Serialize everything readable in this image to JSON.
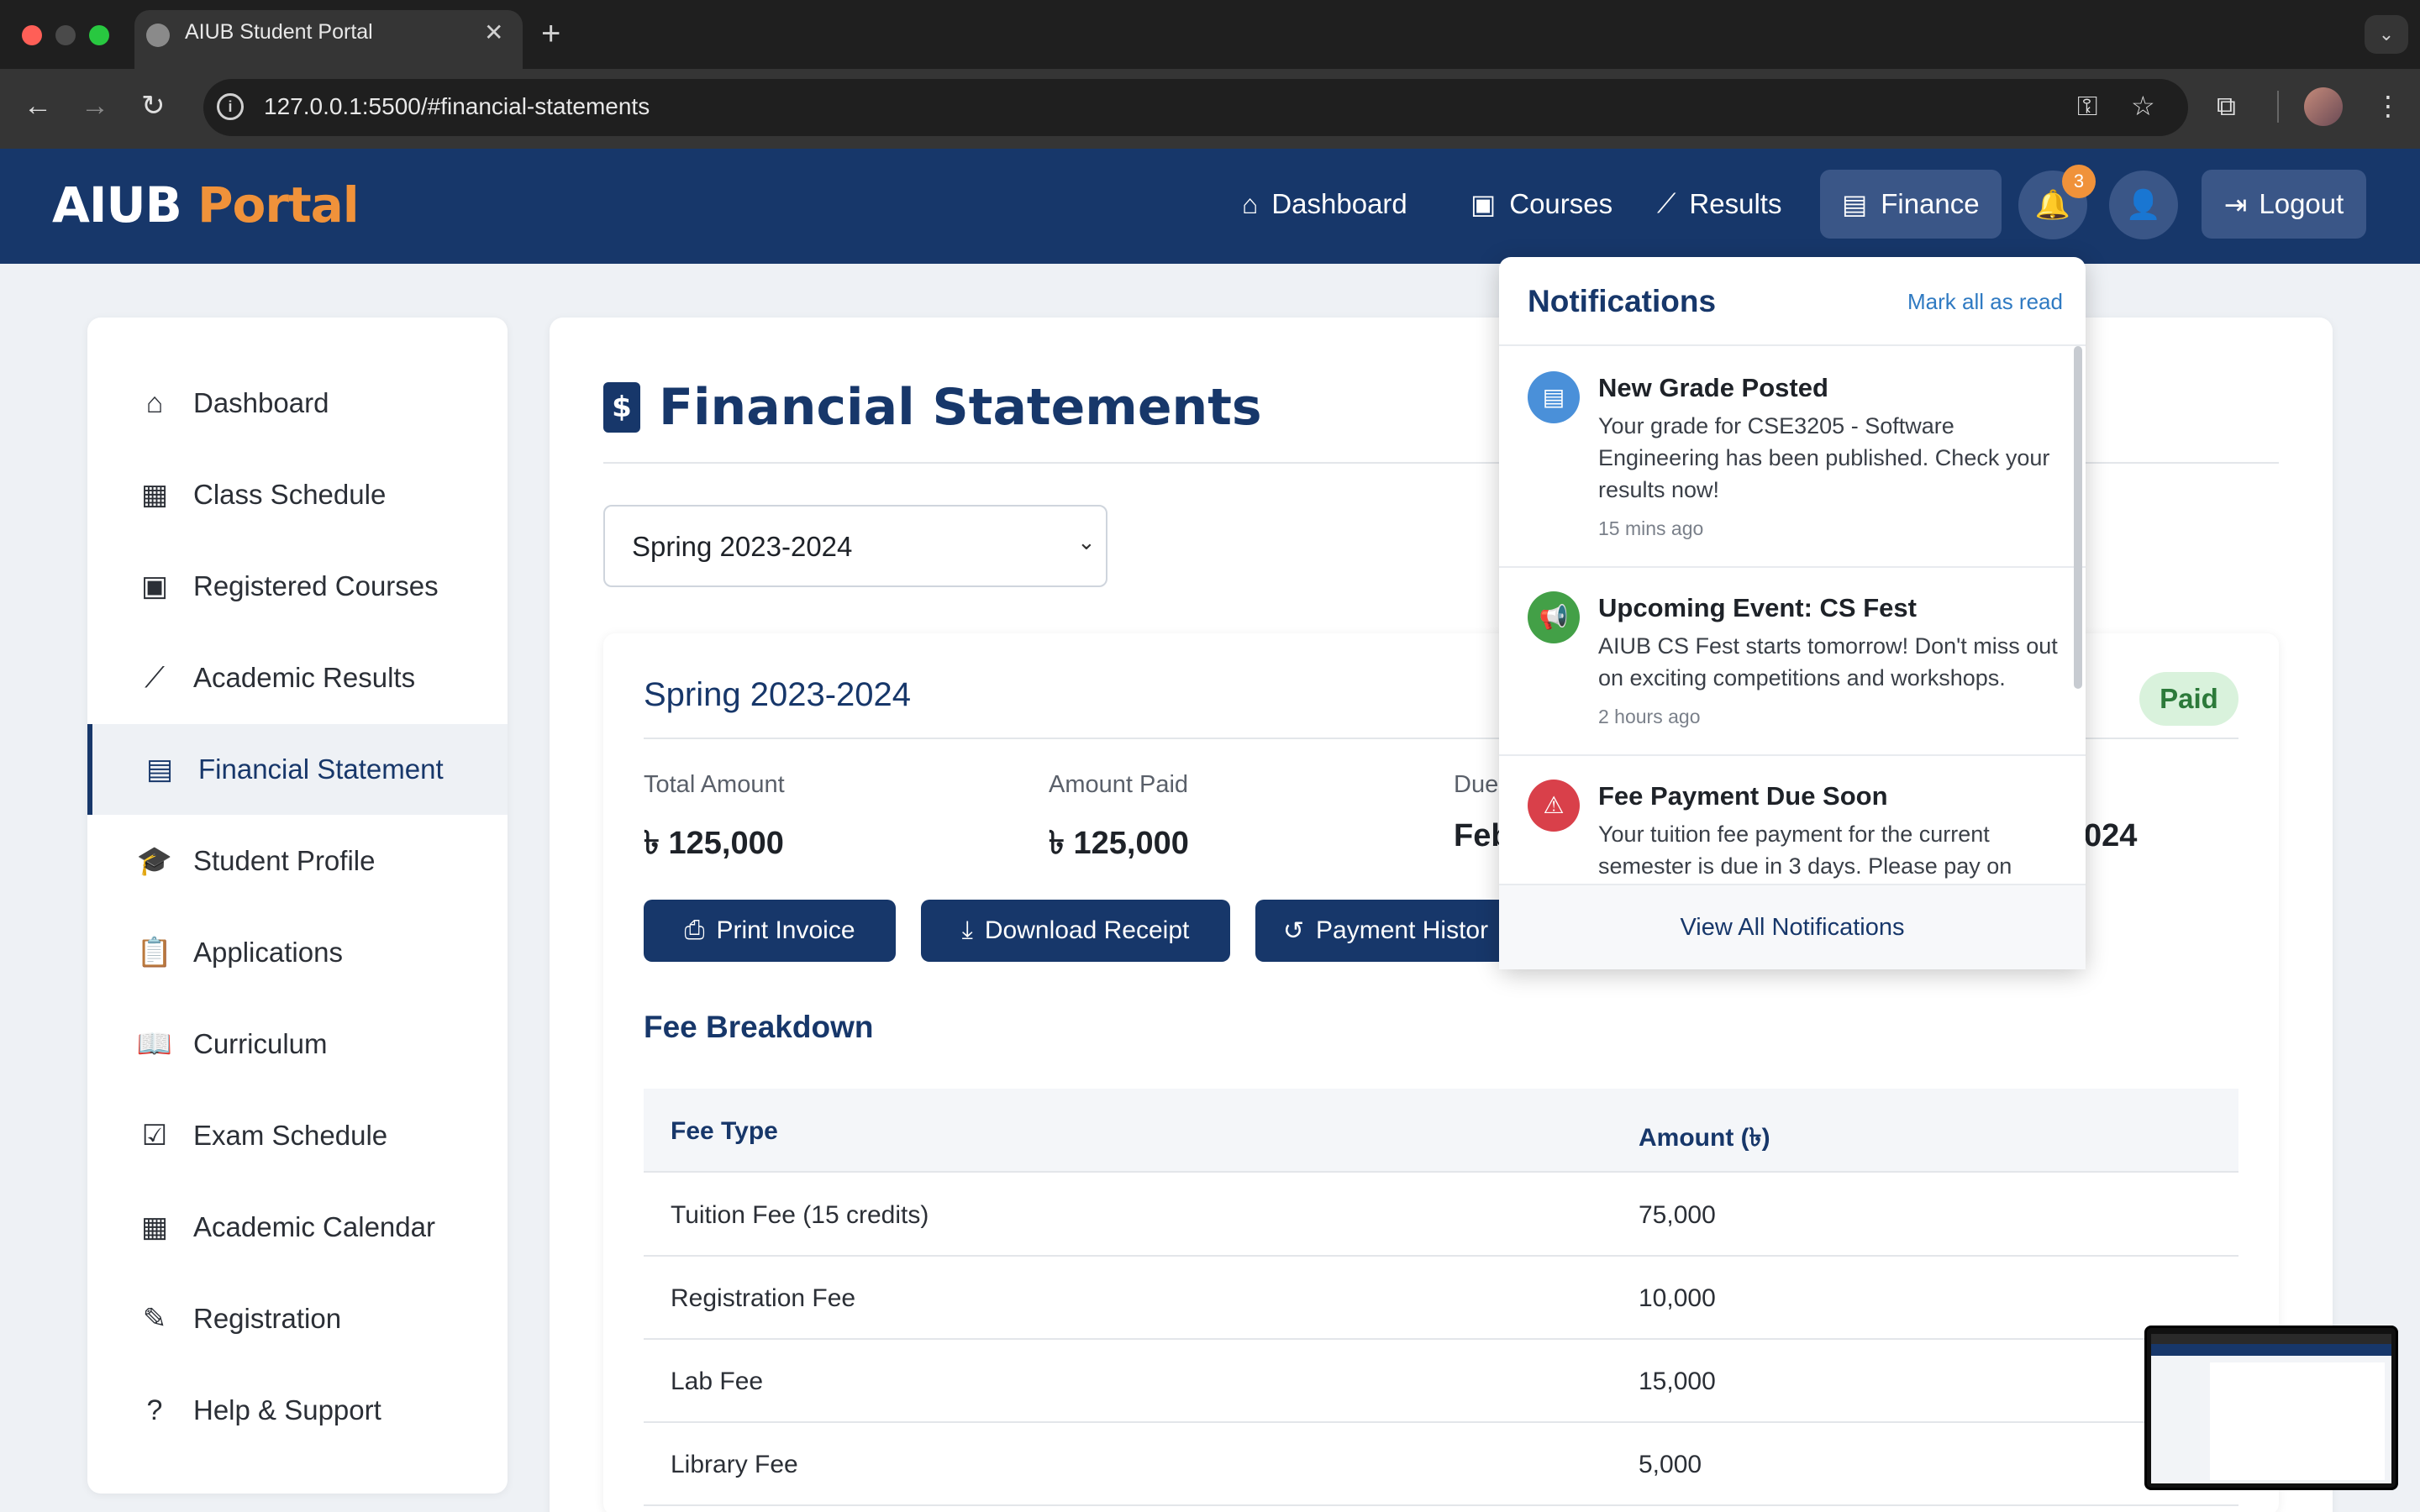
{
  "browser": {
    "tab_title": "AIUB Student Portal",
    "url": "127.0.0.1:5500/#financial-statements"
  },
  "header": {
    "logo_main": "AIUB",
    "logo_accent": "Portal",
    "nav": [
      "Dashboard",
      "Courses",
      "Results",
      "Finance"
    ],
    "active_nav": "Finance",
    "notification_count": "3",
    "logout_label": "Logout"
  },
  "sidebar": {
    "items": [
      {
        "label": "Dashboard",
        "icon": "home-icon"
      },
      {
        "label": "Class Schedule",
        "icon": "calendar-icon"
      },
      {
        "label": "Registered Courses",
        "icon": "book-icon"
      },
      {
        "label": "Academic Results",
        "icon": "chart-line-icon"
      },
      {
        "label": "Financial Statement",
        "icon": "invoice-icon"
      },
      {
        "label": "Student Profile",
        "icon": "graduate-icon"
      },
      {
        "label": "Applications",
        "icon": "clipboard-icon"
      },
      {
        "label": "Curriculum",
        "icon": "open-book-icon"
      },
      {
        "label": "Exam Schedule",
        "icon": "calendar-check-icon"
      },
      {
        "label": "Academic Calendar",
        "icon": "calendar-icon"
      },
      {
        "label": "Registration",
        "icon": "edit-icon"
      },
      {
        "label": "Help & Support",
        "icon": "question-icon"
      }
    ],
    "active": "Financial Statement"
  },
  "main": {
    "title": "Financial Statements",
    "semester_select": "Spring 2023-2024",
    "semester_title": "Spring 2023-2024",
    "status": "Paid",
    "stats": [
      {
        "label": "Total Amount",
        "value": "৳ 125,000"
      },
      {
        "label": "Amount Paid",
        "value": "৳ 125,000"
      },
      {
        "label": "Due",
        "value": "Feb"
      },
      {
        "label": "",
        "value": "024"
      }
    ],
    "buttons": [
      "Print Invoice",
      "Download Receipt",
      "Payment Histor"
    ],
    "fee_breakdown_title": "Fee Breakdown",
    "table": {
      "headers": [
        "Fee Type",
        "Amount (৳)"
      ],
      "rows": [
        [
          "Tuition Fee (15 credits)",
          "75,000"
        ],
        [
          "Registration Fee",
          "10,000"
        ],
        [
          "Lab Fee",
          "15,000"
        ],
        [
          "Library Fee",
          "5,000"
        ]
      ]
    }
  },
  "notifications": {
    "title": "Notifications",
    "mark_all": "Mark all as read",
    "items": [
      {
        "title": "New Grade Posted",
        "body": "Your grade for CSE3205 - Software Engineering has been published. Check your results now!",
        "time": "15 mins ago",
        "icon": "document-icon",
        "color": "#4a90d9"
      },
      {
        "title": "Upcoming Event: CS Fest",
        "body": "AIUB CS Fest starts tomorrow! Don't miss out on exciting competitions and workshops.",
        "time": "2 hours ago",
        "icon": "megaphone-icon",
        "color": "#43a047"
      },
      {
        "title": "Fee Payment Due Soon",
        "body": "Your tuition fee payment for the current semester is due in 3 days. Please pay on",
        "time": "",
        "icon": "warning-icon",
        "color": "#d9404a"
      }
    ],
    "view_all": "View All Notifications"
  }
}
